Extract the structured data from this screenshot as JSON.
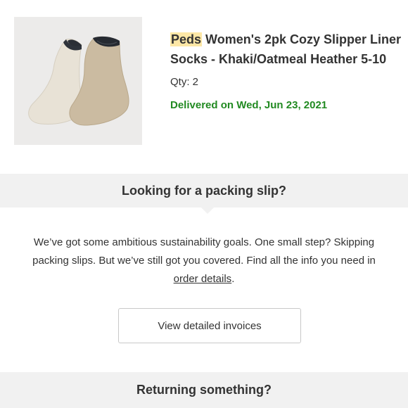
{
  "product": {
    "brand": "Peds",
    "title_rest": " Women's 2pk Cozy Slipper Liner Socks - Khaki/Oatmeal Heather 5-10",
    "qty": "Qty: 2",
    "delivery_status": "Delivered on Wed, Jun 23, 2021",
    "image_icon": "socks-product-image",
    "colors": {
      "highlight": "#fde7a6",
      "delivered": "#218a21"
    }
  },
  "packing_slip": {
    "heading": "Looking for a packing slip?",
    "body_before_link": "We’ve got some ambitious sustainability goals. One small step? Skipping packing slips. But we’ve still got you covered. Find all the info you need in ",
    "link_text": "order details",
    "body_after_link": ".",
    "button_label": "View detailed invoices"
  },
  "returns": {
    "heading": "Returning something?"
  }
}
